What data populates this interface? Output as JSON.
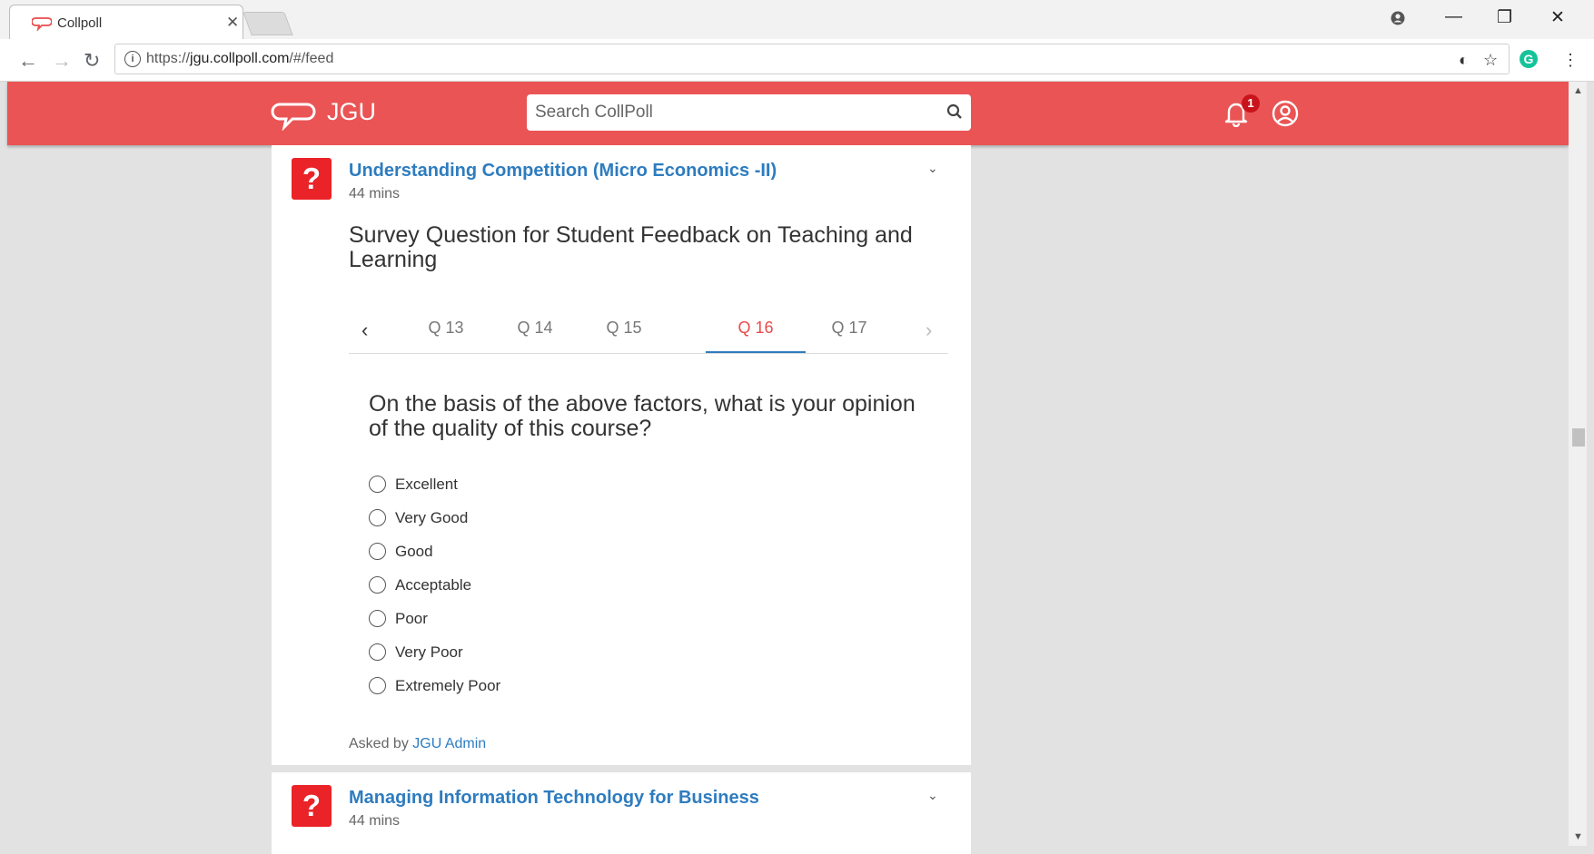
{
  "browser": {
    "tab_title": "Collpoll",
    "url_prefix": "https://",
    "url_host": "jgu.collpoll.com",
    "url_path": "/#/feed"
  },
  "header": {
    "brand": "JGU",
    "search_placeholder": "Search CollPoll",
    "notification_count": "1",
    "accent": "#ea5455"
  },
  "posts": [
    {
      "title": "Understanding Competition (Micro Economics -II)",
      "time": "44 mins",
      "survey_title": "Survey Question for Student Feedback on Teaching and Learning",
      "tabs": [
        "Q 13",
        "Q 14",
        "Q 15",
        "Q 16",
        "Q 17"
      ],
      "active_tab": "Q 16",
      "question": "On the basis of the above factors, what is your opinion of the quality of this course?",
      "options": [
        "Excellent",
        "Very Good",
        "Good",
        "Acceptable",
        "Poor",
        "Very Poor",
        "Extremely Poor"
      ],
      "asked_by_label": "Asked by",
      "asked_by": "JGU Admin"
    },
    {
      "title": "Managing Information Technology for Business",
      "time": "44 mins"
    }
  ]
}
